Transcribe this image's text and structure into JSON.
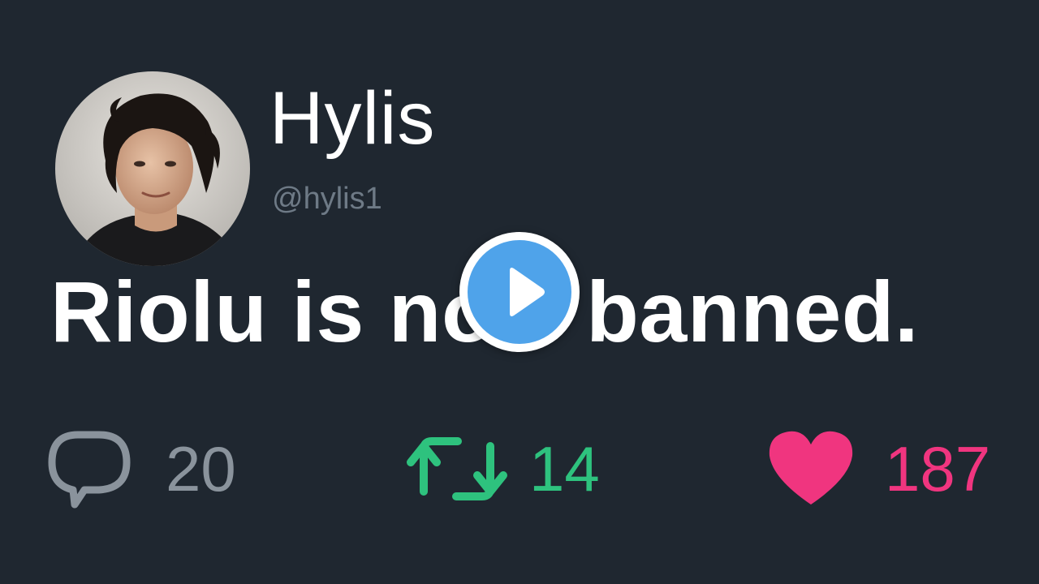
{
  "user": {
    "display_name": "Hylis",
    "handle": "@hylis1",
    "avatar_icon": "profile-photo"
  },
  "tweet": {
    "text": "Riolu is now banned."
  },
  "video": {
    "play_icon": "play-icon",
    "accent_color": "#4fa3ea"
  },
  "actions": {
    "replies": {
      "icon": "reply-bubble-icon",
      "count": "20",
      "color": "#8a939c"
    },
    "retweets": {
      "icon": "retweet-icon",
      "count": "14",
      "color": "#2ec27e"
    },
    "likes": {
      "icon": "heart-icon",
      "count": "187",
      "color": "#f0357f"
    }
  },
  "theme": {
    "background": "#1f2730",
    "text": "#ffffff",
    "muted": "#6e7a86"
  }
}
